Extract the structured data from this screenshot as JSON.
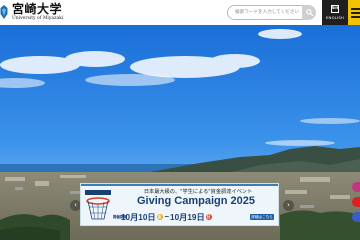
{
  "header": {
    "logo_ja": "宮崎大学",
    "logo_en": "University of Miyazaki",
    "search_placeholder": "検索ワードを入力してください",
    "lang_badge": "En",
    "lang_label": "ENGLISH"
  },
  "banner": {
    "tagline": "日本最大級の、\"学生による\"資金調達イベント",
    "title": "Giving Campaign 2025",
    "period_label": "開催期間",
    "start_date": "10月10日",
    "start_weekday": "金",
    "separator": "–",
    "end_date": "10月19日",
    "end_weekday": "日",
    "details_label": "詳細はこちら"
  },
  "carousel": {
    "prev_symbol": "‹",
    "next_symbol": "›"
  },
  "colors": {
    "accent_yellow": "#f2c200",
    "header_dark": "#1f1f1f",
    "campaign_navy": "#1a3f73"
  }
}
